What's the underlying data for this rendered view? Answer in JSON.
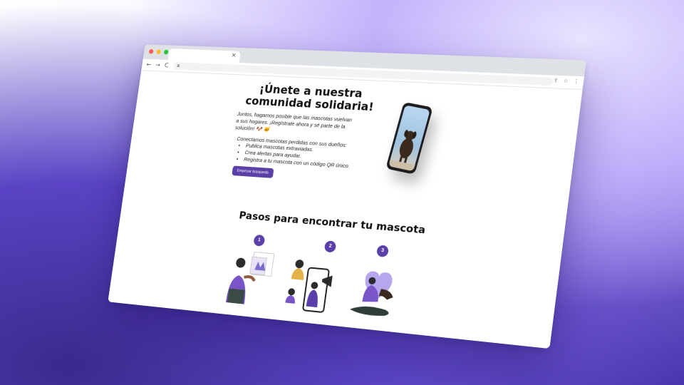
{
  "browser": {
    "tab_close": "×",
    "url": "a",
    "nav": {
      "back": "←",
      "forward": "→",
      "reload": "C"
    },
    "toolbar_icons": {
      "share": "⇪",
      "star": "☆",
      "menu": "⋮"
    }
  },
  "hero": {
    "title_line1": "¡Únete a nuestra",
    "title_line2": "comunidad solidaria!",
    "paragraph": "Juntos, hagamos posible que las mascotas vuelvan a sus hogares. ¡Regístrate ahora y sé parte de la solución! 🐶 🐱",
    "subheading": "Conectamos mascotas perdidas con sus dueños:",
    "features": [
      "Publica mascotas extraviadas.",
      "Crea alertas para ayudar.",
      "Registra a tu mascota con un código QR único."
    ],
    "cta_label": "Empezar búsqueda"
  },
  "steps": {
    "title": "Pasos para encontrar tu mascota",
    "items": [
      {
        "number": "1"
      },
      {
        "number": "2"
      },
      {
        "number": "3"
      }
    ]
  },
  "colors": {
    "accent": "#5a3fa8",
    "background_top": "#efeaff",
    "background_bottom": "#4a35ad"
  }
}
